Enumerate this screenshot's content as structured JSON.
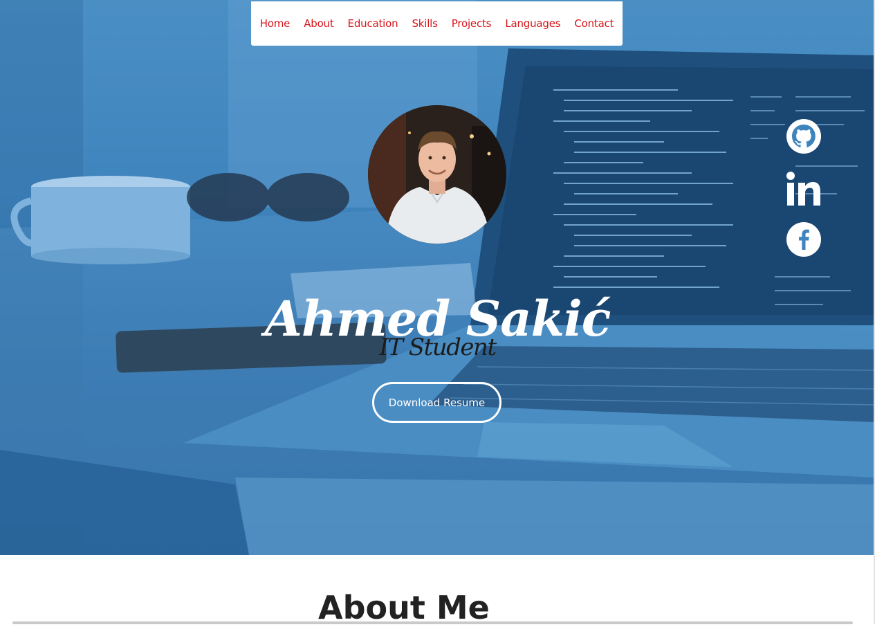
{
  "nav": {
    "items": [
      "Home",
      "About",
      "Education",
      "Skills",
      "Projects",
      "Languages",
      "Contact"
    ]
  },
  "hero": {
    "name": "Ahmed Sakić",
    "subtitle": "IT Student",
    "resume_button": "Download Resume"
  },
  "social": {
    "icons": [
      "github-icon",
      "linkedin-icon",
      "facebook-icon"
    ]
  },
  "about": {
    "title": "About Me"
  },
  "colors": {
    "nav_link": "#d7141a",
    "hero_overlay": "#3f84bd",
    "heading": "#222222"
  }
}
